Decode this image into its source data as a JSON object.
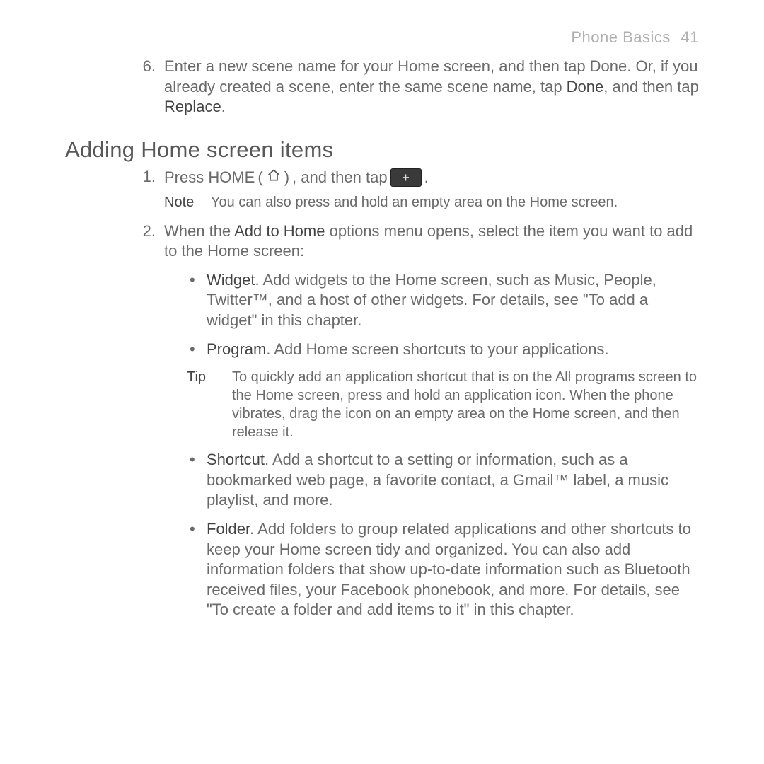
{
  "header": {
    "chapter": "Phone Basics",
    "page_number": "41"
  },
  "step6": {
    "num": "6.",
    "text_a": "Enter a new scene name for your Home screen, and then tap Done. Or, if you already created a scene, enter the same scene name, tap ",
    "bold_a": "Done",
    "text_b": ", and then tap ",
    "bold_b": "Replace",
    "text_c": "."
  },
  "section_title": "Adding Home screen items",
  "step1": {
    "num": "1.",
    "pre": "Press HOME",
    "paren_open": " ( ",
    "paren_close": " )",
    "mid": ", and then tap ",
    "after": "."
  },
  "note": {
    "label": "Note",
    "text": "You can also press and hold an empty area on the Home screen."
  },
  "step2": {
    "num": "2.",
    "text_a": "When the ",
    "bold_a": "Add to Home",
    "text_b": " options menu opens, select the item you want to add to the Home screen:"
  },
  "bullets": {
    "widget": {
      "title": "Widget",
      "text": ". Add widgets to the Home screen, such as Music, People, Twitter™, and a host of other widgets. For details, see \"To add a widget\" in this chapter."
    },
    "program": {
      "title": "Program",
      "text": ". Add Home screen shortcuts to your applications."
    },
    "shortcut": {
      "title": "Shortcut",
      "text": ". Add a shortcut to a setting or information, such as a bookmarked web page, a favorite contact, a Gmail™ label, a music playlist, and more."
    },
    "folder": {
      "title": "Folder",
      "text": ". Add folders to group related applications and other shortcuts to keep your Home screen tidy and organized. You can also add information folders that show up-to-date information such as Bluetooth received files, your Facebook phonebook, and more. For details, see \"To create a folder and add items to it\" in this chapter."
    }
  },
  "tip": {
    "label": "Tip",
    "text": "To quickly add an application shortcut that is on the All programs screen to the Home screen, press and hold an application icon. When the phone vibrates, drag the icon on an empty area on the Home screen, and then release it."
  }
}
